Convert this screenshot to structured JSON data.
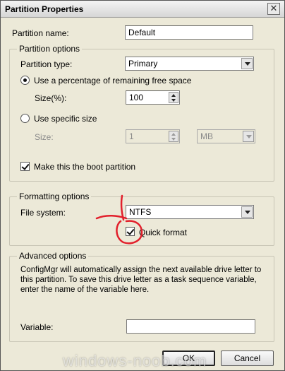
{
  "window": {
    "title": "Partition Properties",
    "close_glyph": "✕"
  },
  "partition_name": {
    "label": "Partition name:",
    "value": "Default"
  },
  "partition_options": {
    "legend": "Partition options",
    "type_label": "Partition type:",
    "type_value": "Primary",
    "percent_option_label": "Use a percentage of remaining free space",
    "percent_selected": true,
    "size_percent_label": "Size(%):",
    "size_percent_value": "100",
    "specific_option_label": "Use specific size",
    "specific_selected": false,
    "size_label": "Size:",
    "size_value": "1",
    "unit_value": "MB",
    "boot_label": "Make this the boot partition",
    "boot_checked": true
  },
  "formatting_options": {
    "legend": "Formatting options",
    "fs_label": "File system:",
    "fs_value": "NTFS",
    "quick_format_label": "Quick format",
    "quick_format_checked": true
  },
  "advanced_options": {
    "legend": "Advanced options",
    "description": "ConfigMgr will automatically assign the next available drive letter to this partition. To save this drive letter as a task sequence variable, enter the name of the variable here.",
    "variable_label": "Variable:",
    "variable_value": ""
  },
  "buttons": {
    "ok": "OK",
    "cancel": "Cancel"
  },
  "watermark": "windows-noob.com",
  "colors": {
    "annotation": "#e2202c",
    "dialog_bg": "#ece9d8"
  }
}
